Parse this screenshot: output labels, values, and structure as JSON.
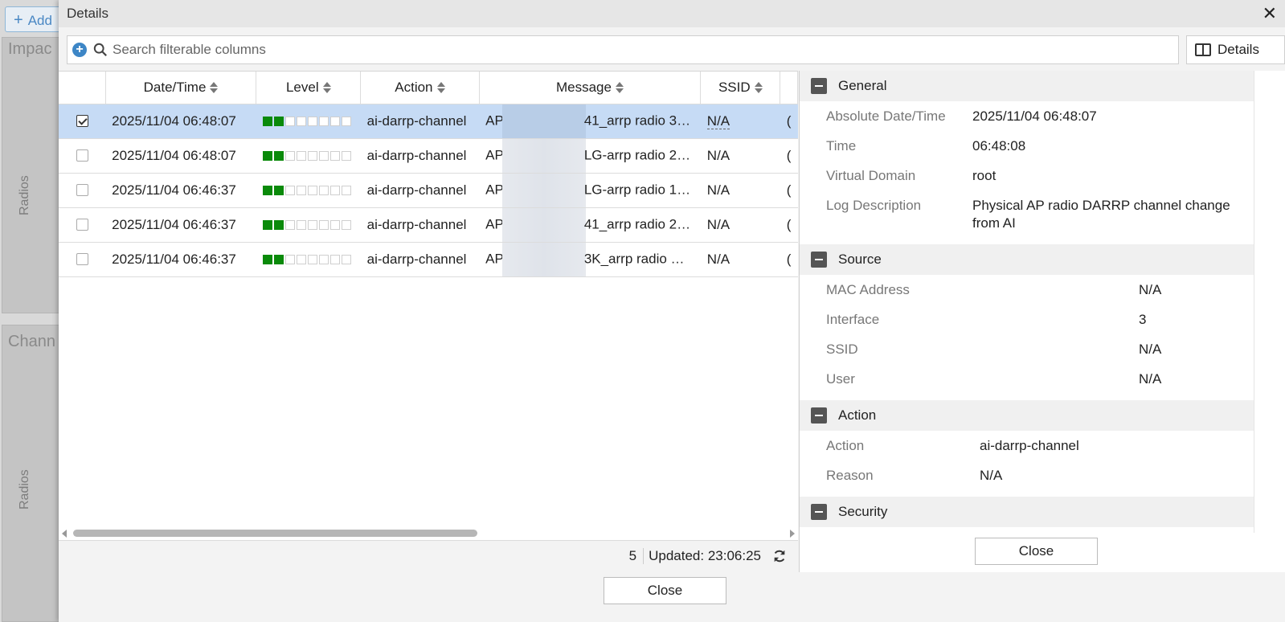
{
  "background": {
    "add_label": "Add",
    "panel1_title": "Impac",
    "panel1_vert": "Radios",
    "panel2_title": "Chann",
    "panel2_vert": "Radios"
  },
  "modal": {
    "title": "Details",
    "close_label": "Close"
  },
  "search": {
    "placeholder": "Search filterable columns"
  },
  "toolbar": {
    "details_label": "Details"
  },
  "table": {
    "columns": [
      "Date/Time",
      "Level",
      "Action",
      "Message",
      "SSID"
    ],
    "rows": [
      {
        "checked": true,
        "datetime": "2025/11/04 06:48:07",
        "level": 2,
        "action": "ai-darrp-channel",
        "msg_prefix": "AP",
        "msg_suffix": "41_arrp radio 3…",
        "ssid": "N/A"
      },
      {
        "checked": false,
        "datetime": "2025/11/04 06:48:07",
        "level": 2,
        "action": "ai-darrp-channel",
        "msg_prefix": "AP",
        "msg_suffix": "LG-arrp radio 2…",
        "ssid": "N/A"
      },
      {
        "checked": false,
        "datetime": "2025/11/04 06:46:37",
        "level": 2,
        "action": "ai-darrp-channel",
        "msg_prefix": "AP",
        "msg_suffix": "LG-arrp radio 1…",
        "ssid": "N/A"
      },
      {
        "checked": false,
        "datetime": "2025/11/04 06:46:37",
        "level": 2,
        "action": "ai-darrp-channel",
        "msg_prefix": "AP",
        "msg_suffix": "41_arrp radio 2…",
        "ssid": "N/A"
      },
      {
        "checked": false,
        "datetime": "2025/11/04 06:46:37",
        "level": 2,
        "action": "ai-darrp-channel",
        "msg_prefix": "AP",
        "msg_suffix": "3K_arrp radio …",
        "ssid": "N/A"
      }
    ],
    "count": "5",
    "updated": "Updated: 23:06:25"
  },
  "details": {
    "general": {
      "title": "General",
      "items": [
        {
          "k": "Absolute Date/Time",
          "v": "2025/11/04 06:48:07"
        },
        {
          "k": "Time",
          "v": "06:48:08"
        },
        {
          "k": "Virtual Domain",
          "v": "root"
        },
        {
          "k": "Log Description",
          "v": "Physical AP radio DARRP channel change from AI"
        }
      ]
    },
    "source": {
      "title": "Source",
      "items": [
        {
          "k": "MAC Address",
          "v": "N/A"
        },
        {
          "k": "Interface",
          "v": "3"
        },
        {
          "k": "SSID",
          "v": "N/A"
        },
        {
          "k": "User",
          "v": "N/A"
        }
      ]
    },
    "action": {
      "title": "Action",
      "items": [
        {
          "k": "Action",
          "v": "ai-darrp-channel"
        },
        {
          "k": "Reason",
          "v": "N/A"
        }
      ]
    },
    "security": {
      "title": "Security"
    },
    "close_label": "Close"
  }
}
